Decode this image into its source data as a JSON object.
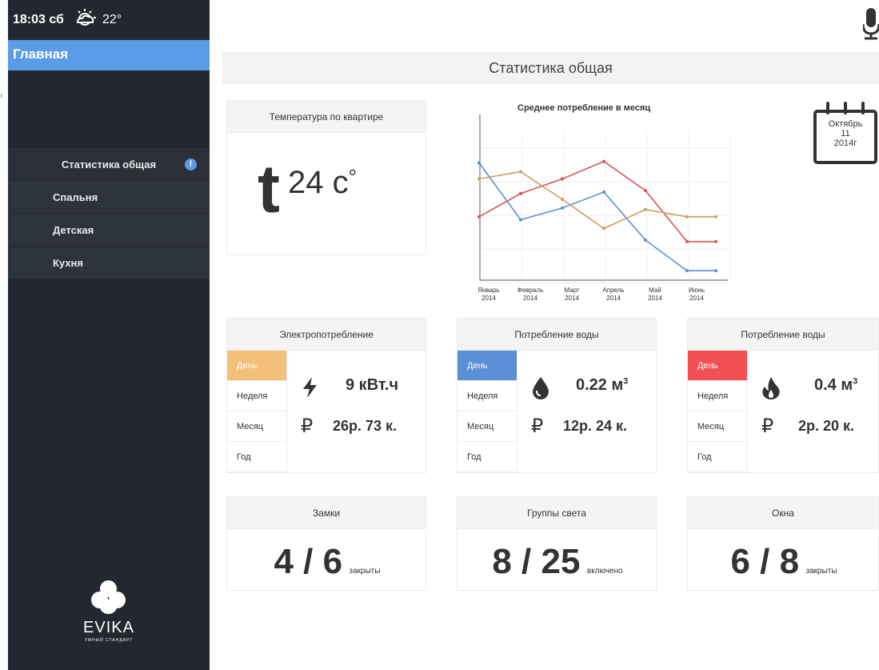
{
  "status": {
    "time": "18:03 сб",
    "weather_icon": "partly-cloudy-icon",
    "temperature": "22°"
  },
  "nav": {
    "home_label": "Главная",
    "items": [
      {
        "label": "Статистика общая",
        "badge": "!"
      },
      {
        "label": "Спальня"
      },
      {
        "label": "Детская"
      },
      {
        "label": "Кухня"
      }
    ]
  },
  "logo": {
    "name": "EVIKA",
    "tagline": "УМНЫЙ СТАНДАРТ"
  },
  "header": {
    "mic_icon": "microphone-icon",
    "title": "Статистика общая"
  },
  "temperature_card": {
    "title": "Температура по квартире",
    "symbol": "t",
    "value": "24 с",
    "degree": "°"
  },
  "calendar": {
    "month": "Октябрь",
    "day": "11",
    "year": "2014г"
  },
  "chart_data": {
    "type": "line",
    "title": "Среднее потребление в месяц",
    "categories": [
      "Январь 2014",
      "Февраль 2014",
      "Март 2014",
      "Апрель 2014",
      "Май 2014",
      "Июнь 2014"
    ],
    "category_lines": [
      [
        "Январь",
        "2014"
      ],
      [
        "Февраль",
        "2014"
      ],
      [
        "Март",
        "2014"
      ],
      [
        "Апрель",
        "2014"
      ],
      [
        "Май",
        "2014"
      ],
      [
        "Июнь",
        "2014"
      ]
    ],
    "ylim": [
      0,
      10
    ],
    "grid": true,
    "series": [
      {
        "color": "#5b8fd6",
        "values": [
          7.5,
          3.6,
          4.4,
          5.5,
          2.2,
          0.1
        ],
        "end": 0.1
      },
      {
        "color": "#d9534f",
        "values": [
          3.8,
          5.4,
          6.4,
          7.6,
          5.6,
          2.1
        ],
        "end": 2.1
      },
      {
        "color": "#c8a065",
        "values": [
          6.4,
          6.9,
          5.0,
          3.0,
          4.3,
          3.8
        ],
        "end": 3.8
      }
    ]
  },
  "usage": [
    {
      "title": "Электропотребление",
      "accent": "#f2c078",
      "icon": "lightning-icon",
      "tabs": [
        "День",
        "Неделя",
        "Месяц",
        "Год"
      ],
      "selected": 0,
      "amount": "9 кВт.ч",
      "amount_sup": "",
      "currency": "₽",
      "cost": "26р. 73 к."
    },
    {
      "title": "Потребление воды",
      "accent": "#5b8fd6",
      "icon": "water-drop-icon",
      "tabs": [
        "День",
        "Неделя",
        "Месяц",
        "Год"
      ],
      "selected": 0,
      "amount": "0.22 м",
      "amount_sup": "3",
      "currency": "₽",
      "cost": "12р. 24 к."
    },
    {
      "title": "Потребление воды",
      "accent": "#f25055",
      "icon": "flame-icon",
      "tabs": [
        "День",
        "Неделя",
        "Месяц",
        "Год"
      ],
      "selected": 0,
      "amount": "0.4 м",
      "amount_sup": "3",
      "currency": "₽",
      "cost": "2р. 20 к."
    }
  ],
  "counters": [
    {
      "title": "Замки",
      "value": "4 / 6",
      "suffix": "закрыты"
    },
    {
      "title": "Группы света",
      "value": "8 / 25",
      "suffix": "включено"
    },
    {
      "title": "Окна",
      "value": "6 / 8",
      "suffix": "закрыты"
    }
  ]
}
